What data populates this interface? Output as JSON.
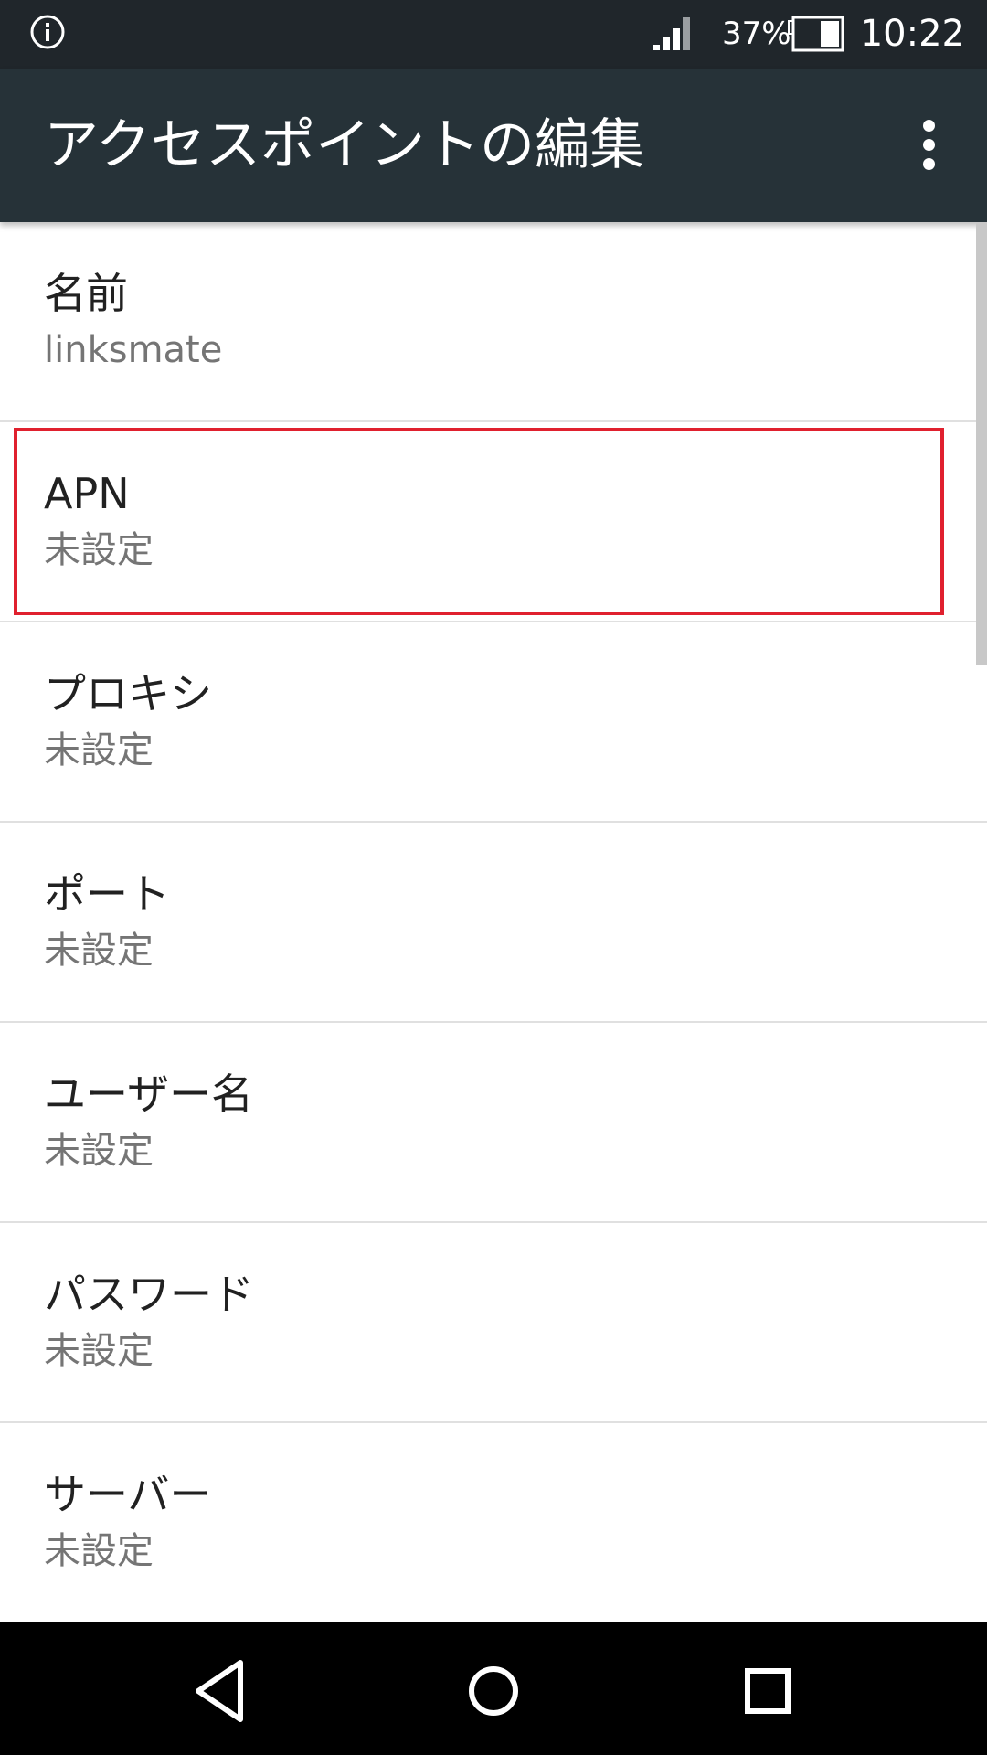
{
  "status_bar": {
    "battery_percent": "37%",
    "time": "10:22",
    "icons": [
      "info-icon",
      "signal-icon",
      "battery-icon"
    ]
  },
  "app_bar": {
    "title": "アクセスポイントの編集",
    "menu_icon": "more-vert-icon"
  },
  "fields": [
    {
      "label": "名前",
      "value": "linksmate"
    },
    {
      "label": "APN",
      "value": "未設定"
    },
    {
      "label": "プロキシ",
      "value": "未設定"
    },
    {
      "label": "ポート",
      "value": "未設定"
    },
    {
      "label": "ユーザー名",
      "value": "未設定"
    },
    {
      "label": "パスワード",
      "value": "未設定"
    },
    {
      "label": "サーバー",
      "value": "未設定"
    }
  ],
  "highlight": {
    "target": "APN",
    "color": "#e0202e"
  },
  "nav_bar": {
    "icons": [
      "back-icon",
      "home-icon",
      "recents-icon"
    ]
  },
  "colors": {
    "status_bar": "#20262b",
    "app_bar": "#263238",
    "title_text": "#212121",
    "value_text": "#757575",
    "divider": "#e0e0e0"
  }
}
